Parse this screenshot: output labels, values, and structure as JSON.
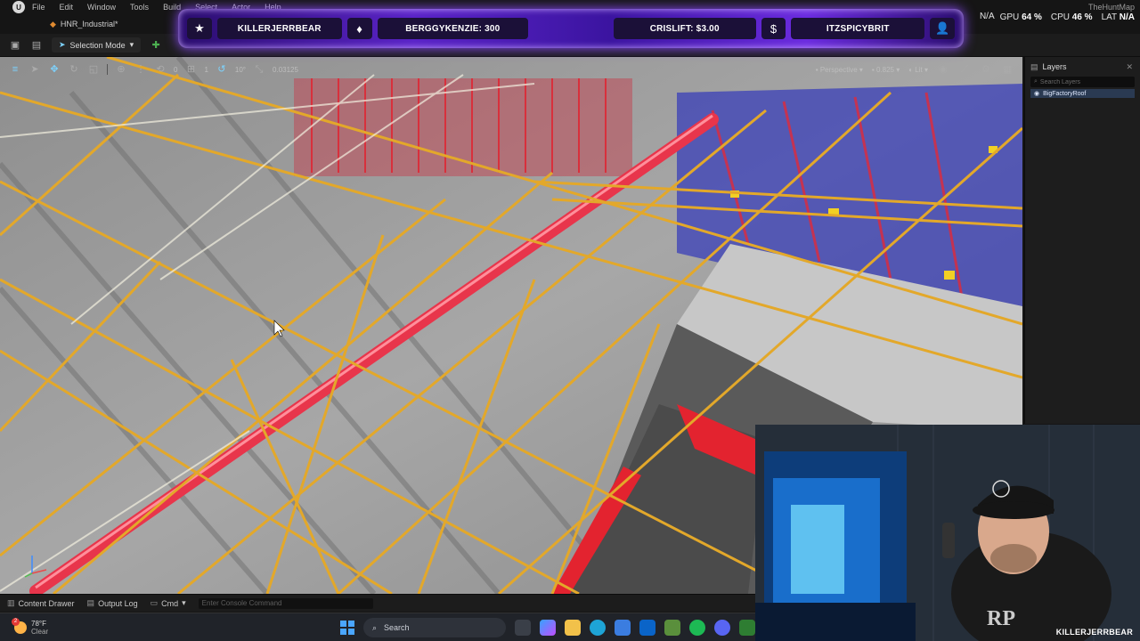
{
  "menubar": {
    "items": [
      "File",
      "Edit",
      "Window",
      "Tools",
      "Build",
      "Select",
      "Actor",
      "Help"
    ]
  },
  "document": {
    "tab_title": "HNR_Industrial*"
  },
  "toolbar": {
    "mode_label": "Selection Mode"
  },
  "stats": {
    "map_name": "TheHuntMap",
    "na_fragment": "N/A",
    "gpu_label": "GPU",
    "gpu_value": "64 %",
    "cpu_label": "CPU",
    "cpu_value": "46 %",
    "lat_label": "LAT",
    "lat_value": "N/A"
  },
  "stream_banner": {
    "cells": [
      "KILLERJERRBEAR",
      "BERGGYKENZIE: 300",
      "CRISLIFT: $3.00",
      "ITZSPICYBRIT"
    ],
    "icons": [
      "star-icon",
      "diamond-icon",
      "dollar-icon",
      "user-icon"
    ]
  },
  "viewport_toolbar": {
    "rotation_snap": "10°",
    "grid_value": "0",
    "scale_value": "1",
    "snap_value": "0.03125",
    "view_mode": "Perspective",
    "camera_speed": "0.825",
    "lighting": "Lit"
  },
  "layers_panel": {
    "title": "Layers",
    "search_placeholder": "Search Layers",
    "items": [
      {
        "label": "BigFactoryRoof"
      }
    ]
  },
  "bottombar": {
    "content_drawer": "Content Drawer",
    "output_log": "Output Log",
    "cmd": "Cmd",
    "console_placeholder": "Enter Console Command"
  },
  "webcam": {
    "name": "KILLERJERRBEAR"
  },
  "taskbar": {
    "temperature": "78°F",
    "condition": "Clear",
    "search_label": "Search"
  },
  "colors": {
    "editor_bg": "#151515",
    "truss_yellow": "#e3a82a",
    "beam_red": "#e8354b",
    "banner_purple": "#5a23c8",
    "layer_selected": "#2a3a52"
  }
}
